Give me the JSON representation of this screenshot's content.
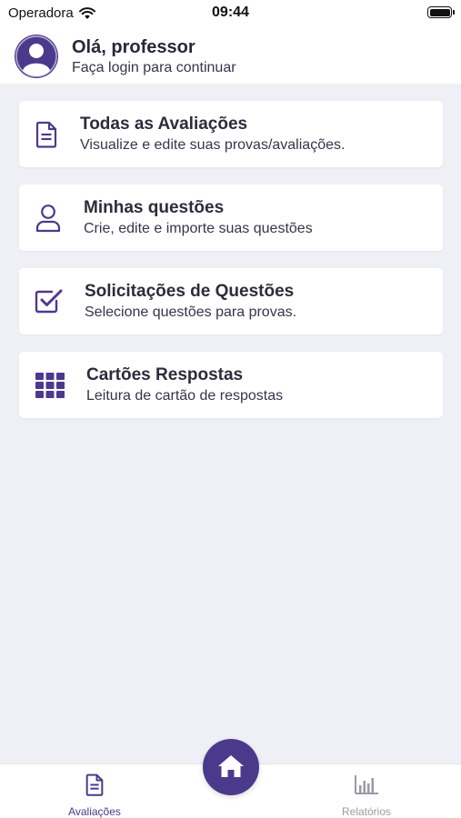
{
  "status_bar": {
    "carrier": "Operadora",
    "time": "09:44",
    "battery_level": 1.0
  },
  "header": {
    "greeting": "Olá, professor",
    "subtitle": "Faça login para continuar",
    "avatar_icon": "user-avatar-icon"
  },
  "cards": [
    {
      "title": "Todas as Avaliações",
      "subtitle": "Visualize e edite suas provas/avaliações.",
      "icon": "document-icon"
    },
    {
      "title": "Minhas questões",
      "subtitle": "Crie, edite e importe suas questões",
      "icon": "user-icon"
    },
    {
      "title": "Solicitações de Questões",
      "subtitle": "Selecione questões para provas.",
      "icon": "checkbox-icon"
    },
    {
      "title": "Cartões Respostas",
      "subtitle": "Leitura de cartão de respostas",
      "icon": "grid-icon"
    }
  ],
  "bottom_nav": {
    "tabs": [
      {
        "label": "Avaliações",
        "icon": "document-icon",
        "active": true
      },
      {
        "label": "Relatórios",
        "icon": "bar-chart-icon",
        "active": false
      }
    ],
    "home_icon": "home-icon"
  },
  "colors": {
    "accent": "#4b3a8c",
    "background": "#eff0f6",
    "inactive": "#9a9aa6"
  }
}
